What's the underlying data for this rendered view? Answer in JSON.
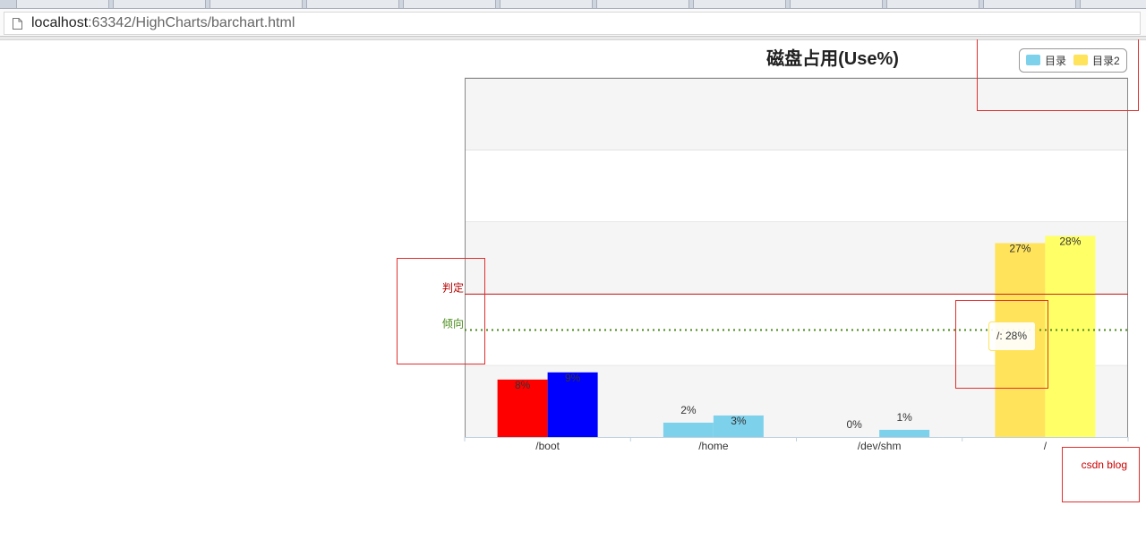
{
  "browser": {
    "url_host": "localhost",
    "url_rest": ":63342/HighCharts/barchart.html"
  },
  "colors": {
    "plot_band_alt": "#f5f5f5",
    "annotation_box": "#e03030",
    "judge_line": "#cc2222",
    "trend_line": "#4a8a1a"
  },
  "chart_data": {
    "type": "bar",
    "title": "磁盘占用(Use%)",
    "categories": [
      "/boot",
      "/home",
      "/dev/shm",
      "/"
    ],
    "ylim": [
      0,
      50
    ],
    "grid": true,
    "legend_placement": "top-right",
    "series": [
      {
        "name": "目录",
        "values": [
          8,
          2,
          0,
          27
        ],
        "color": "#7ed1eb",
        "point_colors": [
          "#ff0000",
          "#7ed1eb",
          "#7ed1eb",
          "#ffe35a"
        ]
      },
      {
        "name": "目录2",
        "values": [
          9,
          3,
          1,
          28
        ],
        "color": "#ffe35a",
        "point_colors": [
          "#0000ff",
          "#7ed1eb",
          "#7ed1eb",
          "#ffff66"
        ]
      }
    ],
    "data_label_texts": [
      [
        "8%",
        "2%",
        "0%",
        "27%"
      ],
      [
        "9%",
        "3%",
        "1%",
        "28%"
      ]
    ],
    "plot_lines": [
      {
        "label": "判定",
        "value": 20,
        "style": "solid",
        "color": "#cc2222",
        "label_color": "#b30000"
      },
      {
        "label": "倾向",
        "value": 15,
        "style": "dotted",
        "color": "#4a8a1a",
        "label_color": "#4a8a1a"
      }
    ],
    "tooltip": {
      "text": "/: 28%",
      "category_index": 3,
      "series_index": 1
    },
    "credits": "csdn blog"
  }
}
